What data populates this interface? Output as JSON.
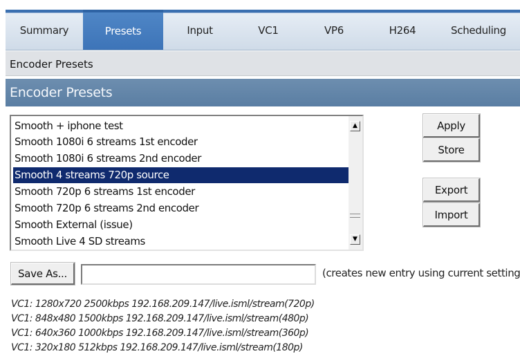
{
  "tabs": [
    {
      "label": "Summary",
      "active": false
    },
    {
      "label": "Presets",
      "active": true
    },
    {
      "label": "Input",
      "active": false
    },
    {
      "label": "VC1",
      "active": false
    },
    {
      "label": "VP6",
      "active": false
    },
    {
      "label": "H264",
      "active": false
    },
    {
      "label": "Scheduling",
      "active": false
    }
  ],
  "breadcrumb": "Encoder Presets",
  "section_title": "Encoder Presets",
  "preset_list": {
    "items": [
      "Smooth + iphone test",
      "Smooth 1080i 6 streams 1st encoder",
      "Smooth 1080i 6 streams 2nd encoder",
      "Smooth 4 streams 720p source",
      "Smooth 720p 6 streams 1st encoder",
      "Smooth 720p 6 streams 2nd encoder",
      "Smooth External (issue)",
      "Smooth Live 4 SD streams"
    ],
    "selected_index": 3
  },
  "buttons": {
    "apply": "Apply",
    "store": "Store",
    "export": "Export",
    "import": "Import",
    "save_as": "Save As..."
  },
  "save_as_input": {
    "value": ""
  },
  "save_as_hint": "(creates new entry using current settings)",
  "summary_lines": [
    "VC1: 1280x720 2500kbps 192.168.209.147/live.isml/stream(720p)",
    "VC1: 848x480 1500kbps 192.168.209.147/live.isml/stream(480p)",
    "VC1: 640x360 1000kbps 192.168.209.147/live.isml/stream(360p)",
    "VC1: 320x180 512kbps 192.168.209.147/live.isml/stream(180p)"
  ],
  "colors": {
    "tab_active": "#3d74b8",
    "section_header": "#5a7ea3",
    "selected_row": "#0f2a6e"
  }
}
